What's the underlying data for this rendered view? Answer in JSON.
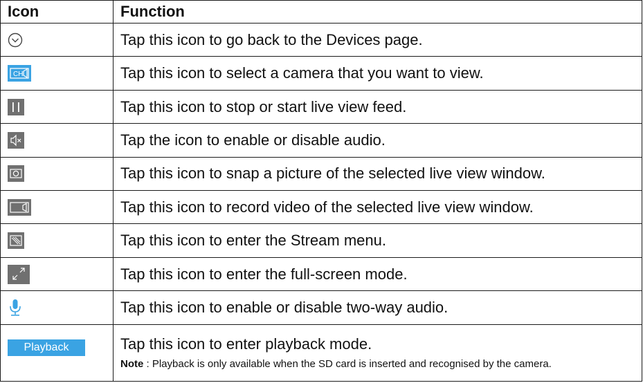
{
  "header": {
    "icon_col": "Icon",
    "function_col": "Function"
  },
  "rows": [
    {
      "icon": "chevron-down-circle-icon",
      "text": "Tap this icon to go back to the Devices page."
    },
    {
      "icon": "camera-select-icon",
      "text": "Tap this icon to select a camera that you want to view."
    },
    {
      "icon": "pause-icon",
      "text": "Tap this icon to stop or start live view feed."
    },
    {
      "icon": "speaker-mute-icon",
      "text": "Tap the icon to enable or disable audio."
    },
    {
      "icon": "snapshot-icon",
      "text": "Tap this icon to snap a picture of the selected live view window."
    },
    {
      "icon": "record-video-icon",
      "text": "Tap this icon to record video of the selected live view window."
    },
    {
      "icon": "stream-menu-icon",
      "text": "Tap this icon to enter the Stream menu."
    },
    {
      "icon": "fullscreen-icon",
      "text": "Tap this icon to enter the full-screen mode."
    },
    {
      "icon": "microphone-icon",
      "text": "Tap this icon to enable or disable two-way audio."
    },
    {
      "icon": "playback-button",
      "icon_label": "Playback",
      "text": "Tap this icon to enter playback mode.",
      "note_label": "Note",
      "note_text": " : Playback is only available when the SD card is inserted and recognised by the camera."
    }
  ],
  "colors": {
    "accent_blue": "#3aa3e3",
    "icon_gray": "#707070",
    "border": "#1a1a1a"
  }
}
